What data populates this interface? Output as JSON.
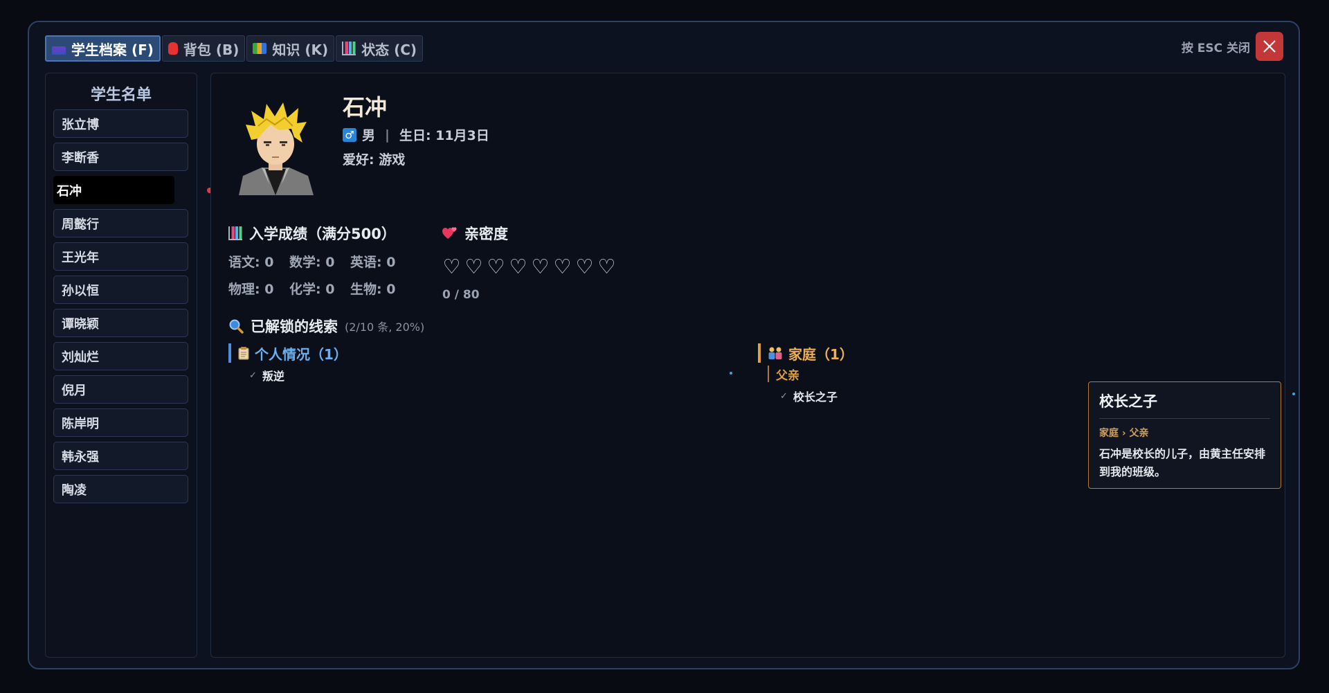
{
  "tabs": [
    {
      "label": "学生档案 (F)",
      "icon": "book-icon",
      "active": true
    },
    {
      "label": "背包 (B)",
      "icon": "backpack-icon",
      "active": false
    },
    {
      "label": "知识 (K)",
      "icon": "books-icon",
      "active": false
    },
    {
      "label": "状态 (C)",
      "icon": "bar-chart-icon",
      "active": false
    }
  ],
  "close": {
    "hint": "按 ESC 关闭"
  },
  "student_list": {
    "title": "学生名单",
    "students": [
      "张立博",
      "李断香",
      "石冲",
      "周懿行",
      "王光年",
      "孙以恒",
      "谭晓颖",
      "刘灿烂",
      "倪月",
      "陈岸明",
      "韩永强",
      "陶凌"
    ],
    "selected": "石冲"
  },
  "profile": {
    "name": "石冲",
    "gender_icon": "♂",
    "gender": "男",
    "separator": "|",
    "birthday": "生日: 11月3日",
    "hobby": "爱好: 游戏"
  },
  "scores": {
    "title": "入学成绩（满分500）",
    "items": [
      "语文: 0",
      "数学: 0",
      "英语: 0",
      "物理: 0",
      "化学: 0",
      "生物: 0"
    ]
  },
  "affinity": {
    "title": "亲密度",
    "heart_count": 8,
    "heart_glyph": "♡",
    "value": "0 / 80"
  },
  "clues": {
    "title": "已解锁的线索",
    "summary": "(2/10 条, 20%)",
    "personal": {
      "label": "个人情况（1）",
      "items": [
        "叛逆"
      ]
    },
    "family": {
      "label": "家庭（1）",
      "sub": "父亲",
      "items": [
        "校长之子"
      ]
    },
    "check_glyph": "✓"
  },
  "tooltip": {
    "title": "校长之子",
    "path": "家庭 › 父亲",
    "body": "石冲是校长的儿子，由黄主任安排到我的班级。"
  },
  "colors": {
    "frame_border": "#2d4163",
    "active_tab": "#2c4a76",
    "close_button": "#c23838",
    "personal_accent": "#4a8fe0",
    "family_accent": "#e0a040"
  }
}
